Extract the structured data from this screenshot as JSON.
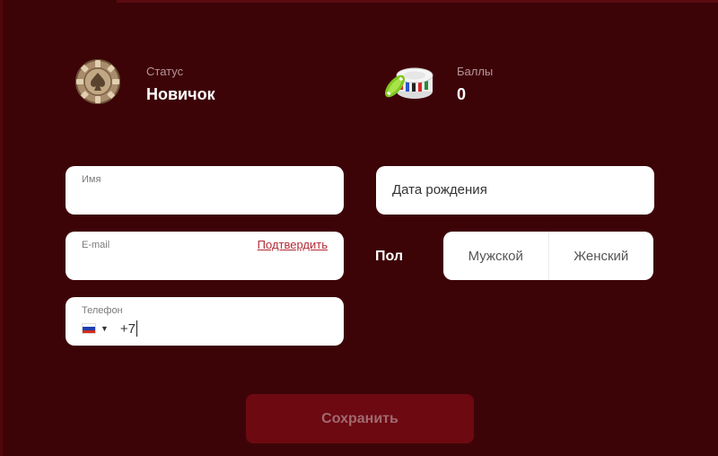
{
  "stats": {
    "status": {
      "label": "Статус",
      "value": "Новичок",
      "icon": "poker-chip-icon"
    },
    "points": {
      "label": "Баллы",
      "value": "0",
      "icon": "chip-stack-icon"
    }
  },
  "form": {
    "name": {
      "label": "Имя",
      "value": ""
    },
    "email": {
      "label": "E-mail",
      "value": "",
      "confirm_label": "Подтвердить"
    },
    "phone": {
      "label": "Телефон",
      "country": "ru-flag-icon",
      "code": "+7"
    },
    "dob": {
      "placeholder": "Дата рождения"
    },
    "gender": {
      "label": "Пол",
      "options": [
        "Мужской",
        "Женский"
      ]
    }
  },
  "actions": {
    "save_label": "Сохранить"
  },
  "colors": {
    "background": "#3d0408",
    "button": "#6d0911",
    "button_text": "#a06a70",
    "link": "#b42a35"
  }
}
